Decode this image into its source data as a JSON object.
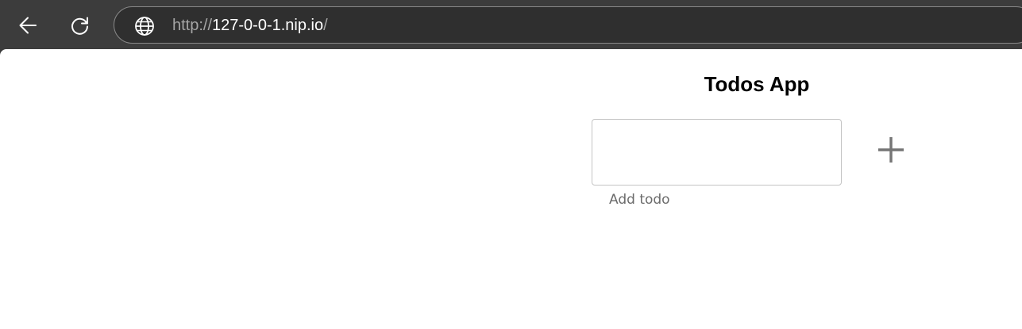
{
  "browser": {
    "url_scheme": "http://",
    "url_host": "127-0-0-1.nip.io",
    "url_slash": "/",
    "icons": {
      "back": "arrow-left-icon",
      "reload": "reload-icon",
      "site": "globe-icon"
    },
    "colors": {
      "toolbar": "#3c3c3c",
      "url_dim": "#a5a5a5",
      "url_host": "#ffffff"
    }
  },
  "app": {
    "title": "Todos App",
    "input": {
      "value": "",
      "label": "Add todo"
    },
    "add_button": {
      "icon": "plus-icon",
      "color": "#757575"
    }
  }
}
